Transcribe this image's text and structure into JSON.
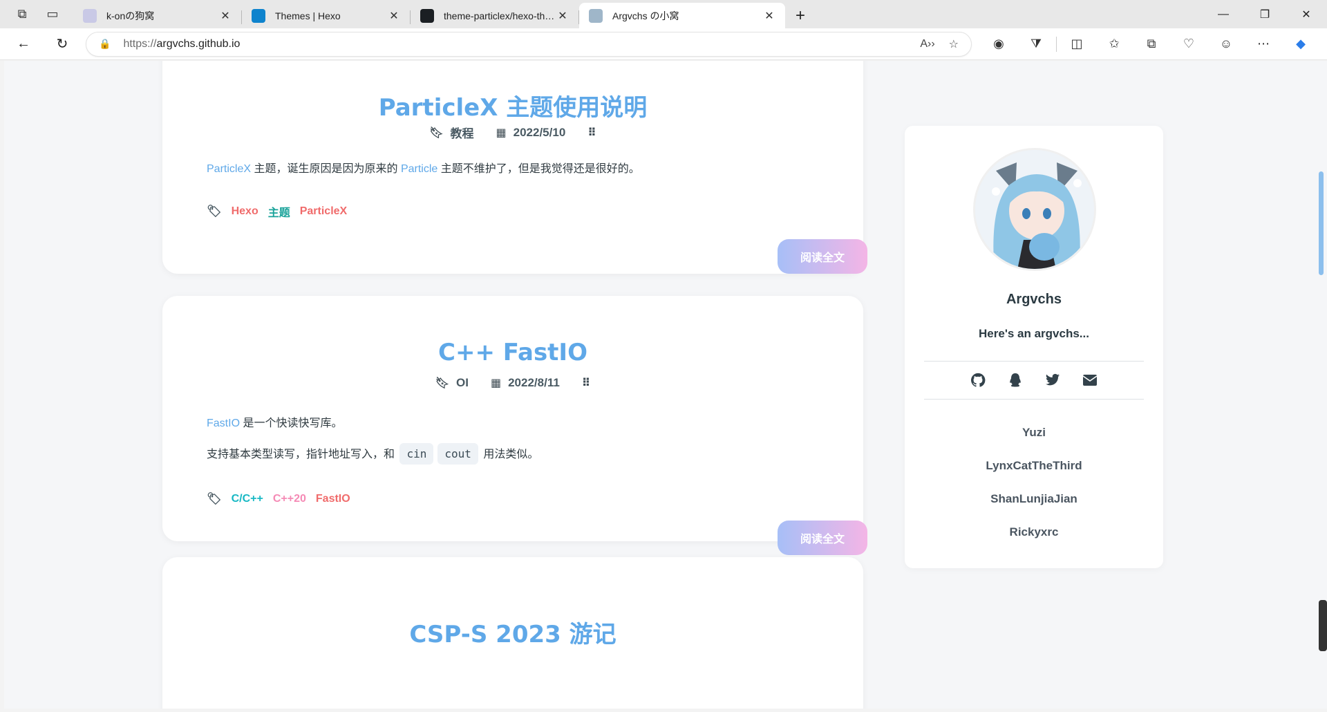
{
  "browser": {
    "tabs": [
      {
        "title": "k-onの狗窝",
        "active": false,
        "favicon_color": "#c9c9e6"
      },
      {
        "title": "Themes | Hexo",
        "active": false,
        "favicon_color": "#0e83cd"
      },
      {
        "title": "theme-particlex/hexo-theme-par",
        "active": false,
        "favicon_color": "#1b1f23"
      },
      {
        "title": "Argvchs の小窝",
        "active": true,
        "favicon_color": "#9fb6c9"
      }
    ],
    "url_protocol": "https://",
    "url_host": "argvchs.github.io"
  },
  "posts": [
    {
      "title": "ParticleX 主题使用说明",
      "category": "教程",
      "date": "2022/5/10",
      "excerpt": [
        {
          "type": "rich",
          "parts": [
            {
              "text": "ParticleX",
              "hl": true
            },
            {
              "text": " 主题，诞生原因是因为原来的 ",
              "hl": false
            },
            {
              "text": "Particle",
              "hl": true
            },
            {
              "text": " 主题不维护了，但是我觉得还是很好的。",
              "hl": false
            }
          ]
        }
      ],
      "tags": [
        {
          "name": "Hexo",
          "color": "#f06b6b"
        },
        {
          "name": "主题",
          "color": "#1aa39a"
        },
        {
          "name": "ParticleX",
          "color": "#f06b6b"
        }
      ],
      "read_more": "阅读全文"
    },
    {
      "title": "C++ FastIO",
      "category": "OI",
      "date": "2022/8/11",
      "excerpt": [
        {
          "type": "rich",
          "parts": [
            {
              "text": "FastIO",
              "hl": true
            },
            {
              "text": " 是一个快读快写库。",
              "hl": false
            }
          ]
        },
        {
          "type": "rich",
          "parts": [
            {
              "text": "支持基本类型读写，指针地址写入，和 ",
              "hl": false
            },
            {
              "text": "cin",
              "code": true
            },
            {
              "text": "cout",
              "code": true
            },
            {
              "text": " 用法类似。",
              "hl": false
            }
          ]
        }
      ],
      "tags": [
        {
          "name": "C/C++",
          "color": "#17b8c4"
        },
        {
          "name": "C++20",
          "color": "#f58ab5"
        },
        {
          "name": "FastIO",
          "color": "#f06b6b"
        }
      ],
      "read_more": "阅读全文"
    },
    {
      "title": "CSP-S 2023 游记"
    }
  ],
  "sidebar": {
    "name": "Argvchs",
    "description": "Here's an argvchs...",
    "social": [
      "github-icon",
      "qq-icon",
      "twitter-icon",
      "email-icon"
    ],
    "friends": [
      "Yuzi",
      "LynxCatTheThird",
      "ShanLunjiaJian",
      "Rickyxrc"
    ]
  }
}
